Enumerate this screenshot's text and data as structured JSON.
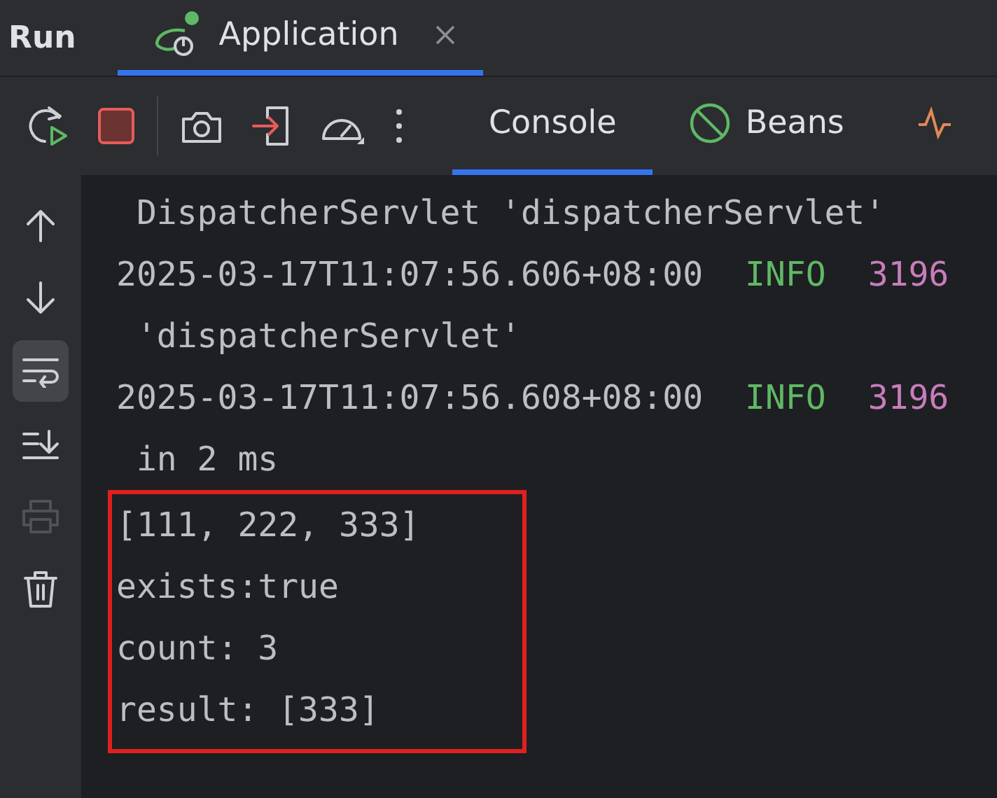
{
  "header": {
    "title": "Run",
    "tabs": [
      {
        "label": "Application",
        "selected": true,
        "running": true
      }
    ]
  },
  "toolbar": {
    "buttons": [
      {
        "kind": "rerun"
      },
      {
        "kind": "stop"
      },
      {
        "kind": "separator"
      },
      {
        "kind": "camera"
      },
      {
        "kind": "exit"
      },
      {
        "kind": "gauge"
      },
      {
        "kind": "more"
      }
    ],
    "tabs": [
      {
        "kind": "console",
        "label": "Console",
        "selected": true
      },
      {
        "kind": "beans",
        "label": "Beans",
        "selected": false
      },
      {
        "kind": "pulse",
        "selected": false
      }
    ]
  },
  "sidebar": [
    {
      "kind": "up",
      "selected": false,
      "disabled": false
    },
    {
      "kind": "down",
      "selected": false,
      "disabled": false
    },
    {
      "kind": "wrap",
      "selected": true,
      "disabled": false
    },
    {
      "kind": "scroll-end",
      "selected": false,
      "disabled": false
    },
    {
      "kind": "print",
      "selected": false,
      "disabled": true
    },
    {
      "kind": "trash",
      "selected": false,
      "disabled": false
    }
  ],
  "console": {
    "lines": [
      {
        "segments": [
          {
            "text": " DispatcherServlet 'dispatcherServlet'",
            "kind": "plain"
          }
        ]
      },
      {
        "segments": [
          {
            "text": "2025-03-17T11:07:56.606+08:00",
            "kind": "plain"
          },
          {
            "text": "INFO",
            "kind": "info"
          },
          {
            "text": "3196",
            "kind": "pid"
          }
        ]
      },
      {
        "segments": [
          {
            "text": " 'dispatcherServlet'",
            "kind": "plain"
          }
        ]
      },
      {
        "segments": [
          {
            "text": "2025-03-17T11:07:56.608+08:00",
            "kind": "plain"
          },
          {
            "text": "INFO",
            "kind": "info"
          },
          {
            "text": "3196",
            "kind": "pid"
          }
        ]
      },
      {
        "segments": [
          {
            "text": " in 2 ms",
            "kind": "plain"
          }
        ]
      }
    ],
    "highlighted_lines": [
      "[111, 222, 333]",
      "exists:true",
      "count: 3",
      "result: [333]"
    ]
  }
}
